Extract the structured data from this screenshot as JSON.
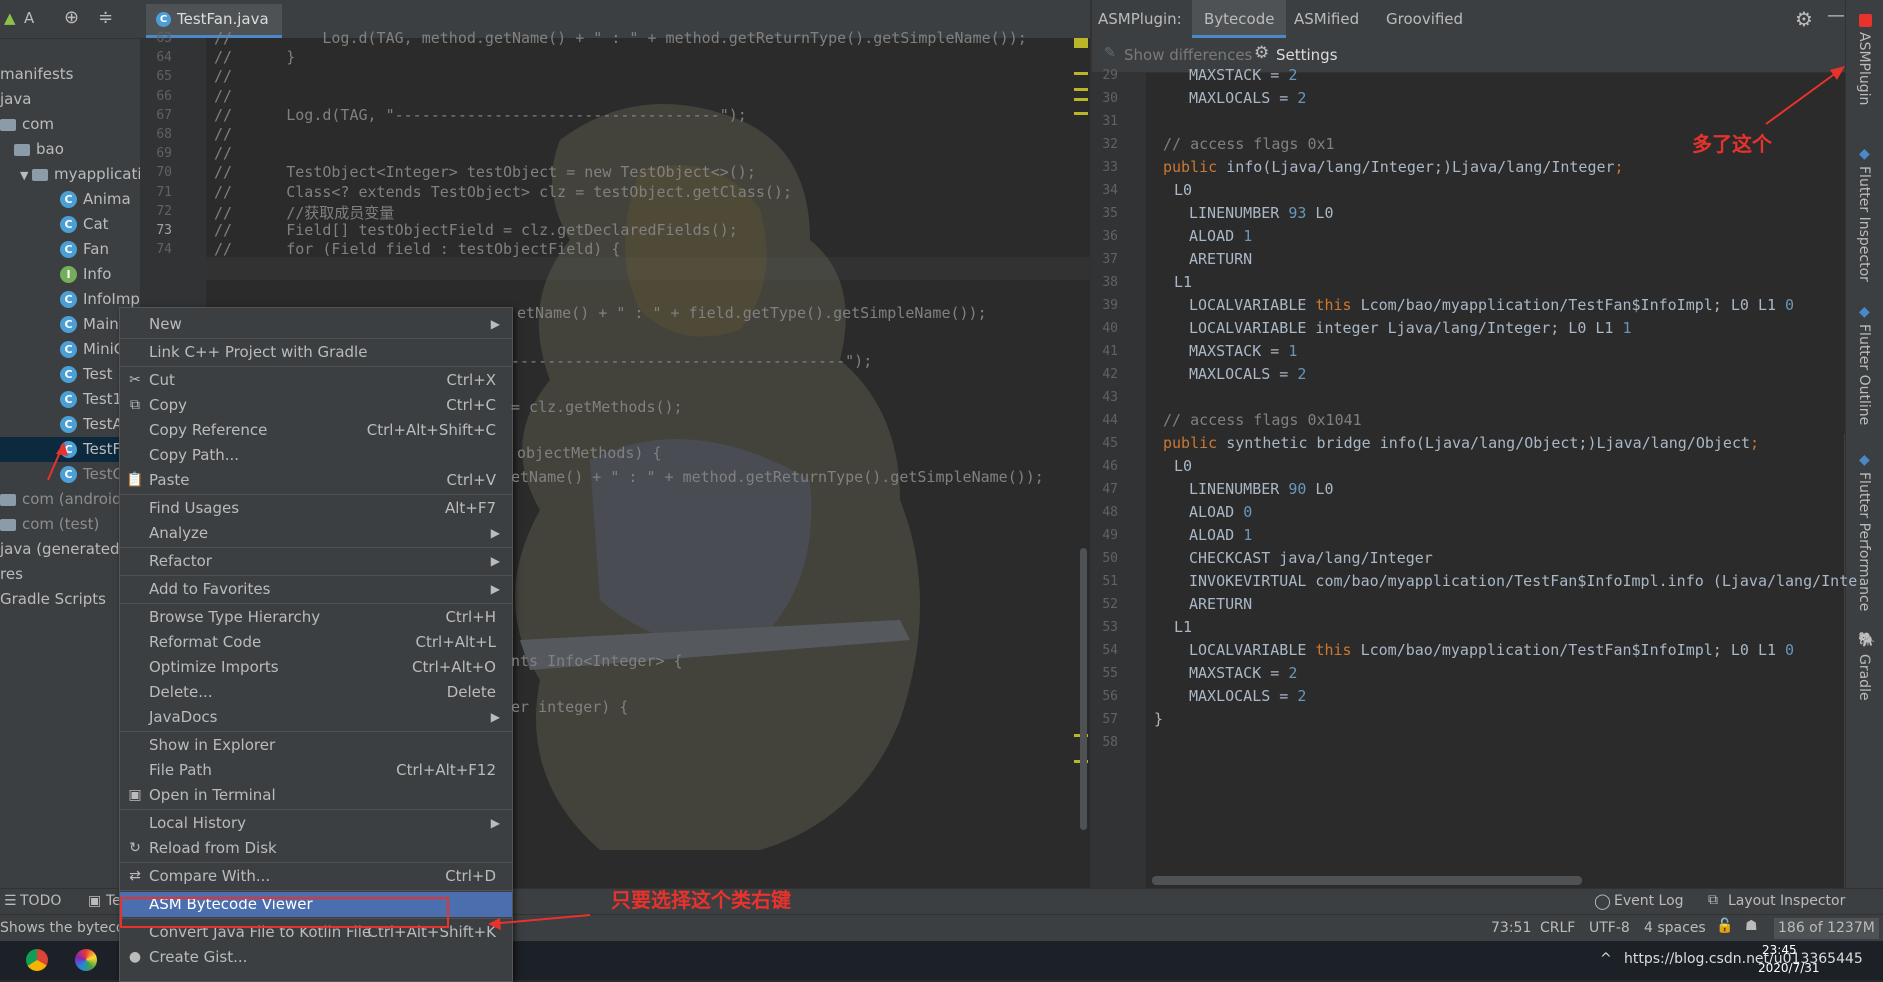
{
  "project": {
    "toolbar_label": "A",
    "items": [
      {
        "label": "manifests",
        "kind": "text"
      },
      {
        "label": "java",
        "kind": "text"
      },
      {
        "label": "com",
        "kind": "folder"
      },
      {
        "label": "bao",
        "kind": "folder"
      },
      {
        "label": "myapplicati",
        "kind": "folder"
      },
      {
        "label": "Anima",
        "kind": "class"
      },
      {
        "label": "Cat",
        "kind": "class"
      },
      {
        "label": "Fan",
        "kind": "class"
      },
      {
        "label": "Info",
        "kind": "interface"
      },
      {
        "label": "InfoImpl",
        "kind": "class"
      },
      {
        "label": "Main",
        "kind": "class"
      },
      {
        "label": "MiniC",
        "kind": "class"
      },
      {
        "label": "Test",
        "kind": "class"
      },
      {
        "label": "Test1",
        "kind": "class"
      },
      {
        "label": "TestA",
        "kind": "class"
      },
      {
        "label": "TestF",
        "kind": "class"
      },
      {
        "label": "TestC",
        "kind": "class"
      },
      {
        "label": "com (androidTe",
        "kind": "folder"
      },
      {
        "label": "com (test)",
        "kind": "folder"
      },
      {
        "label": "java (generated)",
        "kind": "text"
      },
      {
        "label": "res",
        "kind": "text"
      },
      {
        "label": "Gradle Scripts",
        "kind": "text"
      }
    ]
  },
  "editor": {
    "tab_label": "TestFan.java",
    "line_numbers": [
      "63",
      "64",
      "65",
      "66",
      "67",
      "68",
      "69",
      "70",
      "71",
      "72",
      "73",
      "74"
    ],
    "lines": [
      "//          Log.d(TAG, method.getName() + \" : \" + method.getReturnType().getSimpleName());",
      "//      }",
      "//",
      "//",
      "//      Log.d(TAG, \"------------------------------------\");",
      "//",
      "//",
      "//      TestObject<Integer> testObject = new TestObject<>();",
      "//      Class<? extends TestObject> clz = testObject.getClass();",
      "//      //获取成员变量",
      "//      Field[] testObjectField = clz.getDeclaredFields();",
      "//      for (Field field : testObjectField) {"
    ],
    "partial_lines": [
      "etName() + \" : \" + field.getType().getSimpleName());",
      "-------------------------------------\");",
      "= clz.getMethods();",
      "objectMethods) {",
      "etName() + \" : \" + method.getReturnType().getSimpleName());",
      "nts Info<Integer> {",
      "er integer) {"
    ]
  },
  "asm_panel": {
    "title": "ASMPlugin:",
    "tabs": [
      "Bytecode",
      "ASMified",
      "Groovified"
    ],
    "show_differences": "Show differences",
    "settings": "Settings",
    "line_numbers": [
      "29",
      "30",
      "31",
      "32",
      "33",
      "34",
      "35",
      "36",
      "37",
      "38",
      "39",
      "40",
      "41",
      "42",
      "43",
      "44",
      "45",
      "46",
      "47",
      "48",
      "49",
      "50",
      "51",
      "52",
      "53",
      "54",
      "55",
      "56",
      "57",
      "58"
    ],
    "code": [
      {
        "indent": 3,
        "parts": [
          [
            "MAXSTACK = ",
            "t"
          ],
          [
            "2",
            "n"
          ]
        ]
      },
      {
        "indent": 3,
        "parts": [
          [
            "MAXLOCALS = ",
            "t"
          ],
          [
            "2",
            "n"
          ]
        ]
      },
      {
        "indent": 0,
        "parts": []
      },
      {
        "indent": 1,
        "parts": [
          [
            "// access flags 0x1",
            "c"
          ]
        ]
      },
      {
        "indent": 1,
        "parts": [
          [
            "public",
            "k"
          ],
          [
            " info(Ljava/lang/Integer;)Ljava/lang/Integer",
            "t"
          ],
          [
            ";",
            "k"
          ]
        ]
      },
      {
        "indent": 2,
        "parts": [
          [
            "L0",
            "t"
          ]
        ]
      },
      {
        "indent": 3,
        "parts": [
          [
            "LINENUMBER ",
            "t"
          ],
          [
            "93",
            "n"
          ],
          [
            " L0",
            "t"
          ]
        ]
      },
      {
        "indent": 3,
        "parts": [
          [
            "ALOAD ",
            "t"
          ],
          [
            "1",
            "n"
          ]
        ]
      },
      {
        "indent": 3,
        "parts": [
          [
            "ARETURN",
            "t"
          ]
        ]
      },
      {
        "indent": 2,
        "parts": [
          [
            "L1",
            "t"
          ]
        ]
      },
      {
        "indent": 3,
        "parts": [
          [
            "LOCALVARIABLE ",
            "t"
          ],
          [
            "this",
            "k"
          ],
          [
            " Lcom/bao/myapplication/TestFan$InfoImpl; L0 L1 ",
            "t"
          ],
          [
            "0",
            "n"
          ]
        ]
      },
      {
        "indent": 3,
        "parts": [
          [
            "LOCALVARIABLE integer Ljava/lang/Integer; L0 L1 ",
            "t"
          ],
          [
            "1",
            "n"
          ]
        ]
      },
      {
        "indent": 3,
        "parts": [
          [
            "MAXSTACK = ",
            "t"
          ],
          [
            "1",
            "n"
          ]
        ]
      },
      {
        "indent": 3,
        "parts": [
          [
            "MAXLOCALS = ",
            "t"
          ],
          [
            "2",
            "n"
          ]
        ]
      },
      {
        "indent": 0,
        "parts": []
      },
      {
        "indent": 1,
        "parts": [
          [
            "// access flags 0x1041",
            "c"
          ]
        ]
      },
      {
        "indent": 1,
        "parts": [
          [
            "public",
            "k"
          ],
          [
            " synthetic bridge info(Ljava/lang/Object;)Ljava/lang/Object",
            "t"
          ],
          [
            ";",
            "k"
          ]
        ]
      },
      {
        "indent": 2,
        "parts": [
          [
            "L0",
            "t"
          ]
        ]
      },
      {
        "indent": 3,
        "parts": [
          [
            "LINENUMBER ",
            "t"
          ],
          [
            "90",
            "n"
          ],
          [
            " L0",
            "t"
          ]
        ]
      },
      {
        "indent": 3,
        "parts": [
          [
            "ALOAD ",
            "t"
          ],
          [
            "0",
            "n"
          ]
        ]
      },
      {
        "indent": 3,
        "parts": [
          [
            "ALOAD ",
            "t"
          ],
          [
            "1",
            "n"
          ]
        ]
      },
      {
        "indent": 3,
        "parts": [
          [
            "CHECKCAST java/lang/Integer",
            "t"
          ]
        ]
      },
      {
        "indent": 3,
        "parts": [
          [
            "INVOKEVIRTUAL com/bao/myapplication/TestFan$InfoImpl.info (Ljava/lang/Inte",
            "t"
          ]
        ]
      },
      {
        "indent": 3,
        "parts": [
          [
            "ARETURN",
            "t"
          ]
        ]
      },
      {
        "indent": 2,
        "parts": [
          [
            "L1",
            "t"
          ]
        ]
      },
      {
        "indent": 3,
        "parts": [
          [
            "LOCALVARIABLE ",
            "t"
          ],
          [
            "this",
            "k"
          ],
          [
            " Lcom/bao/myapplication/TestFan$InfoImpl; L0 L1 ",
            "t"
          ],
          [
            "0",
            "n"
          ]
        ]
      },
      {
        "indent": 3,
        "parts": [
          [
            "MAXSTACK = ",
            "t"
          ],
          [
            "2",
            "n"
          ]
        ]
      },
      {
        "indent": 3,
        "parts": [
          [
            "MAXLOCALS = ",
            "t"
          ],
          [
            "2",
            "n"
          ]
        ]
      },
      {
        "indent": 0,
        "parts": [
          [
            "}",
            "t"
          ]
        ]
      },
      {
        "indent": 0,
        "parts": []
      }
    ]
  },
  "right_strip": [
    "ASMPlugin",
    "Flutter Inspector",
    "Flutter Outline",
    "Flutter Performance",
    "Gradle"
  ],
  "context_menu": {
    "items": [
      {
        "label": "New",
        "shortcut": "",
        "submenu": true,
        "icon": ""
      },
      {
        "sep": true
      },
      {
        "label": "Link C++ Project with Gradle",
        "shortcut": "",
        "submenu": false,
        "icon": ""
      },
      {
        "sep": true
      },
      {
        "label": "Cut",
        "shortcut": "Ctrl+X",
        "submenu": false,
        "icon": "✂"
      },
      {
        "label": "Copy",
        "shortcut": "Ctrl+C",
        "submenu": false,
        "icon": "⧉"
      },
      {
        "label": "Copy Reference",
        "shortcut": "Ctrl+Alt+Shift+C",
        "submenu": false,
        "icon": ""
      },
      {
        "label": "Copy Path...",
        "shortcut": "",
        "submenu": false,
        "icon": ""
      },
      {
        "label": "Paste",
        "shortcut": "Ctrl+V",
        "submenu": false,
        "icon": "📋"
      },
      {
        "sep": true
      },
      {
        "label": "Find Usages",
        "shortcut": "Alt+F7",
        "submenu": false,
        "icon": ""
      },
      {
        "label": "Analyze",
        "shortcut": "",
        "submenu": true,
        "icon": ""
      },
      {
        "sep": true
      },
      {
        "label": "Refactor",
        "shortcut": "",
        "submenu": true,
        "icon": ""
      },
      {
        "sep": true
      },
      {
        "label": "Add to Favorites",
        "shortcut": "",
        "submenu": true,
        "icon": ""
      },
      {
        "sep": true
      },
      {
        "label": "Browse Type Hierarchy",
        "shortcut": "Ctrl+H",
        "submenu": false,
        "icon": ""
      },
      {
        "label": "Reformat Code",
        "shortcut": "Ctrl+Alt+L",
        "submenu": false,
        "icon": ""
      },
      {
        "label": "Optimize Imports",
        "shortcut": "Ctrl+Alt+O",
        "submenu": false,
        "icon": ""
      },
      {
        "label": "Delete...",
        "shortcut": "Delete",
        "submenu": false,
        "icon": ""
      },
      {
        "label": "JavaDocs",
        "shortcut": "",
        "submenu": true,
        "icon": ""
      },
      {
        "sep": true
      },
      {
        "label": "Show in Explorer",
        "shortcut": "",
        "submenu": false,
        "icon": ""
      },
      {
        "label": "File Path",
        "shortcut": "Ctrl+Alt+F12",
        "submenu": false,
        "icon": ""
      },
      {
        "label": "Open in Terminal",
        "shortcut": "",
        "submenu": false,
        "icon": "▣"
      },
      {
        "sep": true
      },
      {
        "label": "Local History",
        "shortcut": "",
        "submenu": true,
        "icon": ""
      },
      {
        "label": "Reload from Disk",
        "shortcut": "",
        "submenu": false,
        "icon": "↻"
      },
      {
        "sep": true
      },
      {
        "label": "Compare With...",
        "shortcut": "Ctrl+D",
        "submenu": false,
        "icon": "⇄"
      },
      {
        "sep": true
      },
      {
        "label": "ASM Bytecode Viewer",
        "shortcut": "",
        "submenu": false,
        "icon": "",
        "selected": true
      },
      {
        "sep": true
      },
      {
        "label": "Convert Java File to Kotlin File",
        "shortcut": "Ctrl+Alt+Shift+K",
        "submenu": false,
        "icon": ""
      },
      {
        "label": "Create Gist...",
        "shortcut": "",
        "submenu": false,
        "icon": "●"
      }
    ]
  },
  "annotations": {
    "right_click_hint": "只要选择这个类右键",
    "new_plugin_hint": "多了这个"
  },
  "bottom_tools": {
    "todo": "TODO",
    "te": "Te",
    "event_log": "Event Log",
    "layout_inspector": "Layout Inspector"
  },
  "status": {
    "message": "Shows the bytecod",
    "position": "73:51",
    "line_sep": "CRLF",
    "encoding": "UTF-8",
    "indent": "4 spaces",
    "memory": "186 of 1237M"
  },
  "taskbar": {
    "time": "23:45",
    "date": "2020/7/31",
    "url_hint": "https://blog.csdn.net/u013365445"
  },
  "colors": {
    "accent": "#4b6eaf",
    "annotation": "#e8322c",
    "keyword": "#cc7832",
    "number": "#6897bb"
  }
}
